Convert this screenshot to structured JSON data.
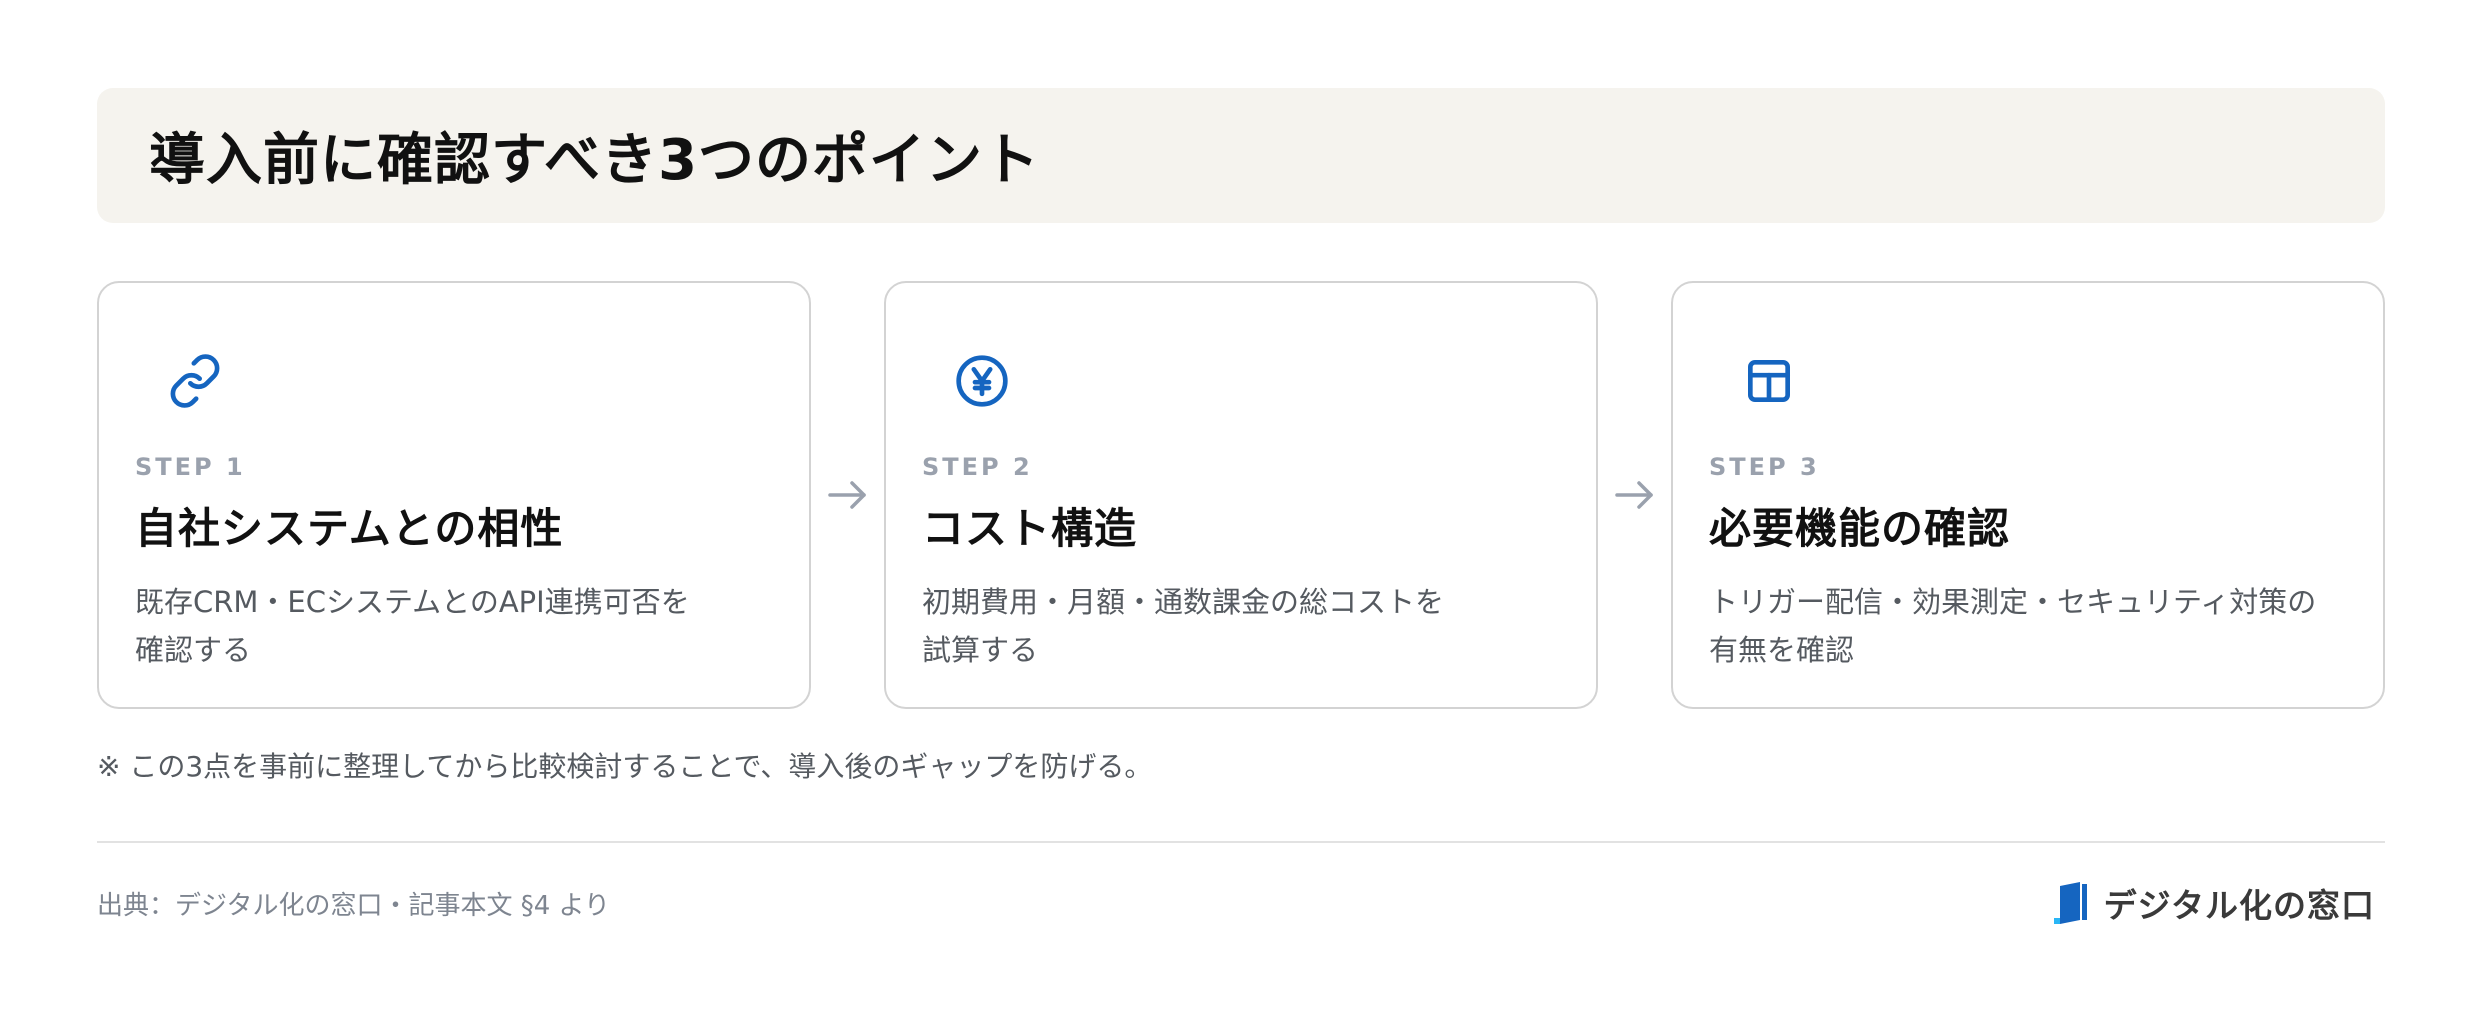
{
  "header": {
    "title": "導入前に確認すべき3つのポイント"
  },
  "steps": [
    {
      "icon": "link-icon",
      "label": "STEP 1",
      "title": "自社システムとの相性",
      "desc_line1": "既存CRM・ECシステムとのAPI連携可否を",
      "desc_line2": "確認する"
    },
    {
      "icon": "yen-coin-icon",
      "label": "STEP 2",
      "title": "コスト構造",
      "desc_line1": "初期費用・月額・通数課金の総コストを",
      "desc_line2": "試算する"
    },
    {
      "icon": "layout-grid-icon",
      "label": "STEP 3",
      "title": "必要機能の確認",
      "desc_line1": "トリガー配信・効果測定・セキュリティ対策の",
      "desc_line2": "有無を確認"
    }
  ],
  "note": "※ この3点を事前に整理してから比較検討することで、導入後のギャップを防げる。",
  "footer": {
    "source": "出典：デジタル化の窓口・記事本文 §4 より",
    "brand_name": "デジタル化の窓口",
    "brand_icon": "brand-logo-icon"
  },
  "colors": {
    "accent": "#1565c0",
    "title_band": "#f5f3ee",
    "step_label": "#9aa1ad",
    "arrow": "#9aa1ad"
  }
}
